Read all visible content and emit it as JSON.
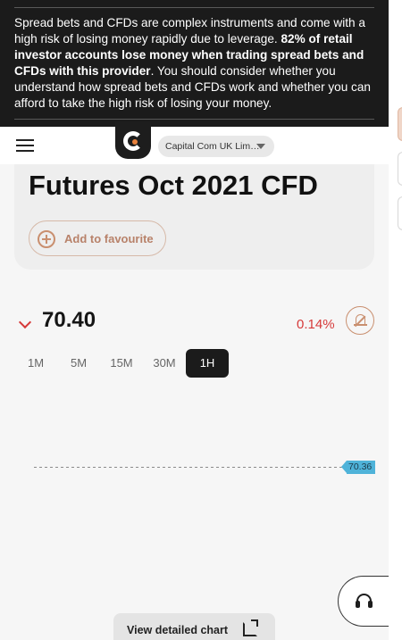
{
  "risk_warning": {
    "part1": "Spread bets and CFDs are complex instruments and come with a high risk of losing money rapidly due to leverage. ",
    "bold": "82% of retail investor accounts lose money when trading spread bets and CFDs with this provider",
    "part2": ". You should consider whether you understand how spread bets and CFDs work and whether you can afford to take the high risk of losing your money."
  },
  "header": {
    "entity_label": "Capital Com UK Lim…"
  },
  "instrument": {
    "title": "Futures Oct 2021 CFD",
    "add_favourite_label": "Add to favourite"
  },
  "quote": {
    "price": "70.40",
    "change": "0.14%",
    "direction": "down",
    "change_color": "#d63a3a"
  },
  "timeframes": {
    "items": [
      "1M",
      "5M",
      "15M",
      "30M",
      "1H"
    ],
    "selected": "1H"
  },
  "chart_data": {
    "type": "line",
    "series": [],
    "current_price_label": "70.36",
    "price_line_style": "dashed"
  },
  "actions": {
    "detail_chart_label": "View detailed chart"
  },
  "icons": {
    "menu": "hamburger-icon",
    "logo": "capital-com-logo",
    "caret": "caret-down-icon",
    "favourite": "plus-circle-icon",
    "trend": "chevron-down-icon",
    "alert": "bell-off-icon",
    "support": "headset-icon",
    "external": "external-link-icon"
  },
  "colors": {
    "accent": "#c98f6f",
    "negative": "#d63a3a",
    "price_tag": "#4fb3d9",
    "banner_bg": "#1b1b1b"
  }
}
